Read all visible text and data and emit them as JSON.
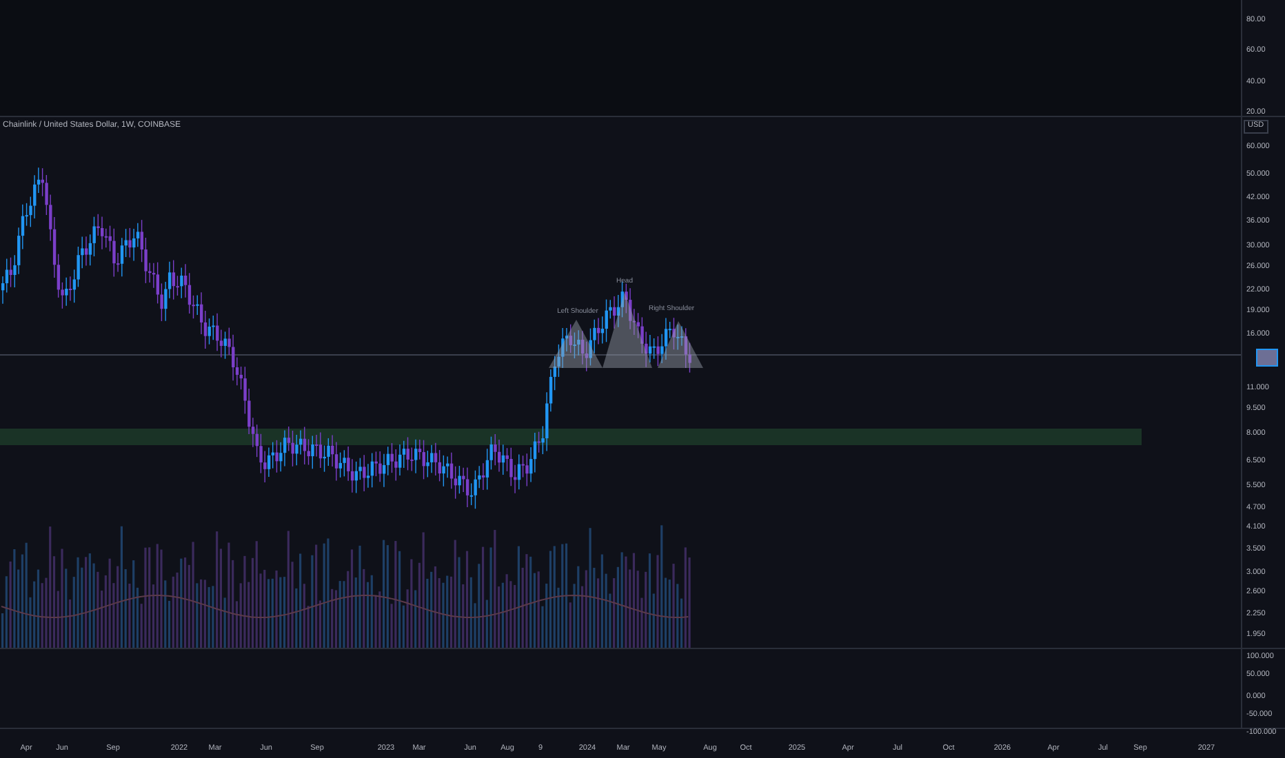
{
  "upper_pane": {
    "price_axis": [
      "80.00",
      "60.00",
      "40.00",
      "20.00"
    ]
  },
  "main_pane": {
    "symbol_title": "Chainlink / United States Dollar, 1W, COINBASE",
    "currency": "USD",
    "price_axis": [
      "60.000",
      "50.000",
      "42.000",
      "36.000",
      "30.000",
      "26.000",
      "22.000",
      "19.000",
      "16.000",
      "11.000",
      "9.500",
      "8.000",
      "6.500",
      "5.500",
      "4.700",
      "4.100",
      "3.500",
      "3.000",
      "2.600",
      "2.250",
      "1.950"
    ],
    "pattern_labels": [
      "Left Shoulder",
      "Head",
      "Right Shoulder"
    ]
  },
  "lower_pane": {
    "price_axis": [
      "100.000",
      "50.000",
      "0.000",
      "-50.000",
      "-100.000"
    ]
  },
  "time_axis": [
    "Apr",
    "Jun",
    "Sep",
    "2022",
    "Mar",
    "Jun",
    "Sep",
    "2023",
    "Mar",
    "Jun",
    "Aug",
    "9",
    "2024",
    "Mar",
    "May",
    "Aug",
    "Oct",
    "2025",
    "Apr",
    "Jul",
    "Oct",
    "2026",
    "Apr",
    "Jul",
    "Sep",
    "2027"
  ]
}
